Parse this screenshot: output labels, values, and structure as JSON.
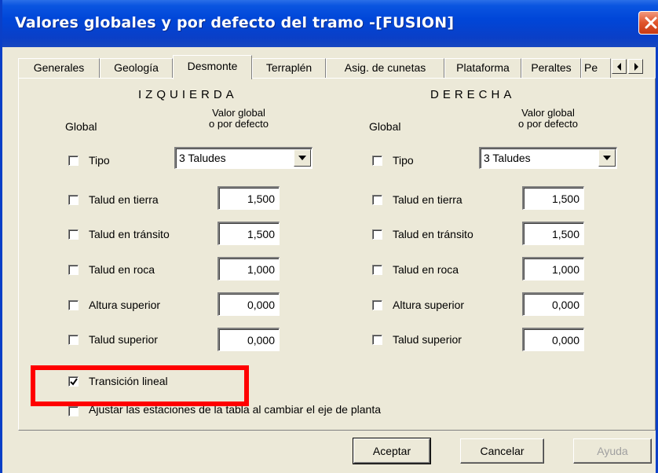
{
  "window": {
    "title": "Valores globales y por defecto del tramo -[FUSION]"
  },
  "tabs": [
    {
      "label": "Generales"
    },
    {
      "label": "Geología"
    },
    {
      "label": "Desmonte"
    },
    {
      "label": "Terraplén"
    },
    {
      "label": "Asig. de cunetas"
    },
    {
      "label": "Plataforma"
    },
    {
      "label": "Peraltes"
    },
    {
      "label": "Pe"
    }
  ],
  "left": {
    "heading": "IZQUIERDA",
    "global_label": "Global",
    "value_header_1": "Valor global",
    "value_header_2": "o por defecto",
    "tipo_label": "Tipo",
    "tipo_value": "3 Taludes",
    "rows": [
      {
        "label": "Talud en tierra",
        "value": "1,500"
      },
      {
        "label": "Talud en tránsito",
        "value": "1,500"
      },
      {
        "label": "Talud en roca",
        "value": "1,000"
      },
      {
        "label": "Altura superior",
        "value": "0,000"
      },
      {
        "label": "Talud superior",
        "value": "0,000"
      }
    ]
  },
  "right": {
    "heading": "DERECHA",
    "global_label": "Global",
    "value_header_1": "Valor global",
    "value_header_2": "o por defecto",
    "tipo_label": "Tipo",
    "tipo_value": "3 Taludes",
    "rows": [
      {
        "label": "Talud en tierra",
        "value": "1,500"
      },
      {
        "label": "Talud en tránsito",
        "value": "1,500"
      },
      {
        "label": "Talud en roca",
        "value": "1,000"
      },
      {
        "label": "Altura superior",
        "value": "0,000"
      },
      {
        "label": "Talud superior",
        "value": "0,000"
      }
    ]
  },
  "options": {
    "transicion_label": "Transición lineal",
    "transicion_checked": true,
    "ajustar_label": "Ajustar las estaciones de la tabla al cambiar el eje de planta"
  },
  "buttons": {
    "ok": "Aceptar",
    "cancel": "Cancelar",
    "help": "Ayuda"
  },
  "colors": {
    "titlebar": "#0a3fc7",
    "highlight": "#ff0000",
    "dialog_bg": "#ece9d8"
  }
}
